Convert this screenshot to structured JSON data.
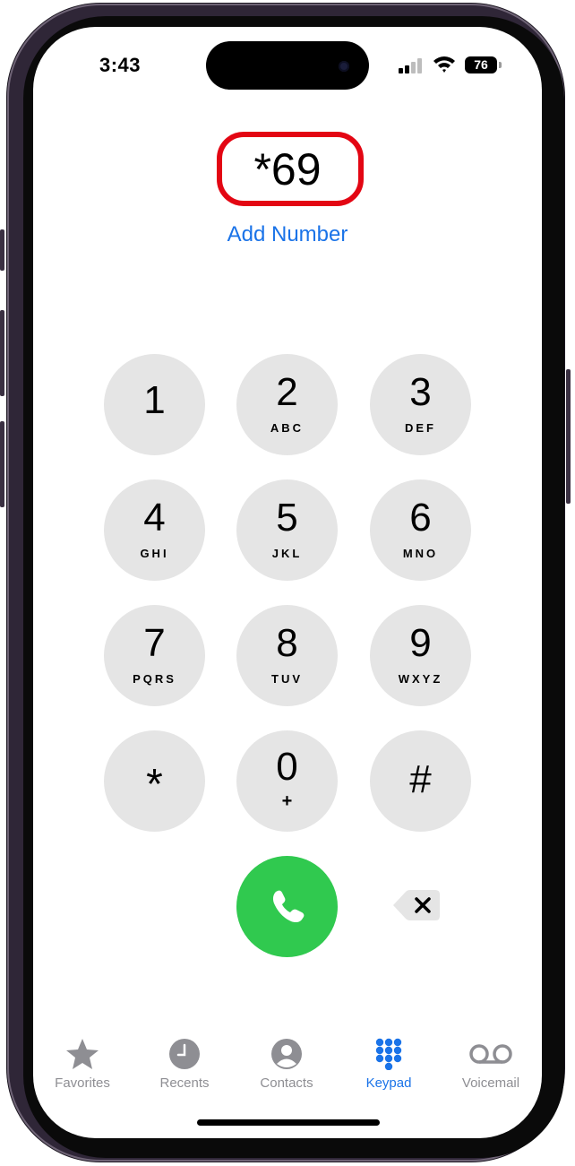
{
  "status_bar": {
    "time": "3:43",
    "battery": "76"
  },
  "dialer": {
    "number": "*69",
    "add_number": "Add Number"
  },
  "keypad": [
    {
      "digit": "1",
      "letters": ""
    },
    {
      "digit": "2",
      "letters": "ABC"
    },
    {
      "digit": "3",
      "letters": "DEF"
    },
    {
      "digit": "4",
      "letters": "GHI"
    },
    {
      "digit": "5",
      "letters": "JKL"
    },
    {
      "digit": "6",
      "letters": "MNO"
    },
    {
      "digit": "7",
      "letters": "PQRS"
    },
    {
      "digit": "8",
      "letters": "TUV"
    },
    {
      "digit": "9",
      "letters": "WXYZ"
    },
    {
      "digit": "*",
      "letters": ""
    },
    {
      "digit": "0",
      "letters": "+"
    },
    {
      "digit": "#",
      "letters": ""
    }
  ],
  "tabs": [
    {
      "label": "Favorites",
      "icon": "star-icon"
    },
    {
      "label": "Recents",
      "icon": "clock-icon"
    },
    {
      "label": "Contacts",
      "icon": "person-icon"
    },
    {
      "label": "Keypad",
      "icon": "keypad-grid-icon"
    },
    {
      "label": "Voicemail",
      "icon": "voicemail-icon"
    }
  ],
  "colors": {
    "accent": "#1a73e8",
    "call": "#30c94f",
    "highlight": "#e30613",
    "key": "#e5e5e5"
  },
  "active_tab": "Keypad"
}
